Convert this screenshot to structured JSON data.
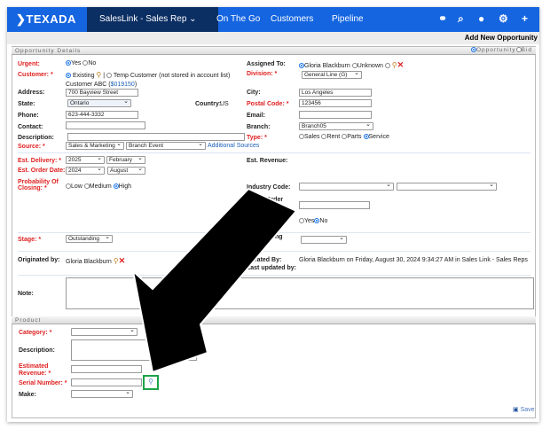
{
  "nav": {
    "logo": "TEXADA",
    "app": "SalesLink - Sales Rep",
    "links": [
      "On The Go",
      "Customers",
      "Pipeline"
    ]
  },
  "page_title": "Add New Opportunity",
  "details": {
    "section": "Opportunity Details",
    "mode_options": [
      "Opportunity",
      "Bid"
    ],
    "urgent": {
      "label": "Urgent:",
      "options": [
        "Yes",
        "No"
      ]
    },
    "customer": {
      "label": "Customer: *",
      "existing": "Existing",
      "temp": "Temp Customer (not stored in account list)",
      "name": "Customer ABC (",
      "code": "$019150",
      ")": ")"
    },
    "address": {
      "label": "Address:",
      "value": "700 Bayview Street"
    },
    "state": {
      "label": "State:",
      "value": "Ontario"
    },
    "country": {
      "label": "Country:",
      "value": "US"
    },
    "phone": {
      "label": "Phone:",
      "value": "623-444-3332"
    },
    "contact": {
      "label": "Contact:"
    },
    "description": {
      "label": "Description:"
    },
    "source": {
      "label": "Source: *",
      "value1": "Sales & Marketing",
      "value2": "Branch Event",
      "link": "Additional Sources"
    },
    "assigned": {
      "label": "Assigned To:",
      "options": [
        "Gloria Blackburn",
        "Unknown"
      ]
    },
    "division": {
      "label": "Division: *",
      "value": "General Line (G)"
    },
    "city": {
      "label": "City:",
      "value": "Los Angeles"
    },
    "postal": {
      "label": "Postal Code: *",
      "value": "123456"
    },
    "email": {
      "label": "Email:"
    },
    "branch": {
      "label": "Branch:",
      "value": "Branch05"
    },
    "type": {
      "label": "Type: *",
      "options": [
        "Sales",
        "Rent",
        "Parts",
        "Service"
      ]
    },
    "est_delivery": {
      "label": "Est. Delivery: *",
      "year": "2025",
      "month": "February"
    },
    "est_order": {
      "label": "Est. Order Date: *",
      "year": "2024",
      "month": "August"
    },
    "probability": {
      "label": "Probability Of Closing: *",
      "options": [
        "Low",
        "Medium",
        "High"
      ]
    },
    "est_revenue": {
      "label": "Est. Revenue:"
    },
    "industry": {
      "label": "Industry Code:"
    },
    "order_label": "Order",
    "yesno": [
      "Yes",
      "No"
    ],
    "stage": {
      "label": "Stage: *",
      "value": "Outstanding"
    },
    "stage_right_label": "ng",
    "originated": {
      "label": "Originated by:",
      "value": "Gloria Blackburn"
    },
    "created": {
      "label": "Created By:",
      "value": "Gloria Blackburn on Friday, August 30, 2024 9:34:27 AM in Sales Link - Sales Reps"
    },
    "updated": {
      "label": "Last updated by:"
    },
    "note": {
      "label": "Note:"
    }
  },
  "product": {
    "section": "Product",
    "category": "Category: *",
    "description": "Description:",
    "est_rev_1": "Estimated",
    "est_rev_2": "Revenue: *",
    "serial": "Serial Number: *",
    "make": "Make:"
  },
  "save": "Save"
}
